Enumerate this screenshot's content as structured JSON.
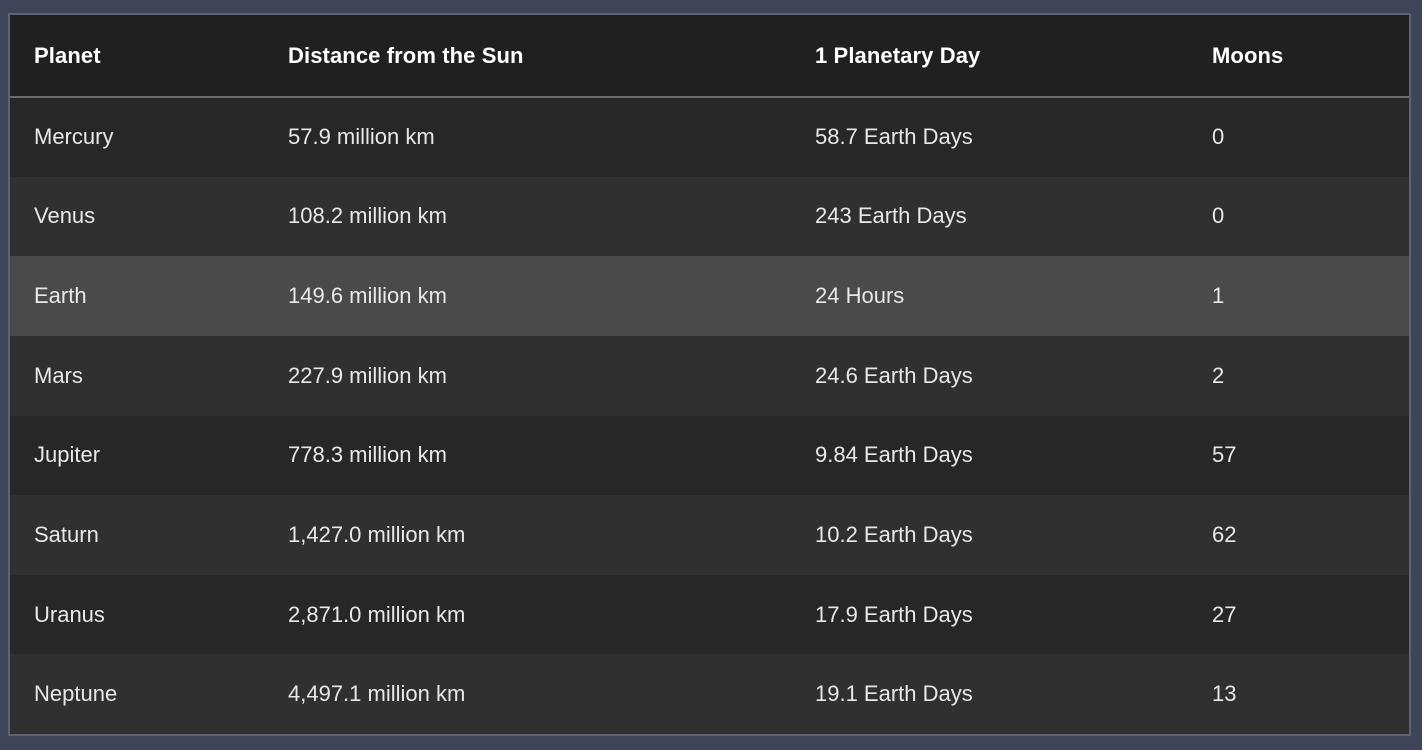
{
  "table": {
    "headers": {
      "planet": "Planet",
      "distance": "Distance from the Sun",
      "day": "1 Planetary Day",
      "moons": "Moons"
    },
    "rows": [
      {
        "planet": "Mercury",
        "distance": "57.9 million km",
        "day": "58.7 Earth Days",
        "moons": "0"
      },
      {
        "planet": "Venus",
        "distance": "108.2 million km",
        "day": "243 Earth Days",
        "moons": "0"
      },
      {
        "planet": "Earth",
        "distance": "149.6 million km",
        "day": "24 Hours",
        "moons": "1"
      },
      {
        "planet": "Mars",
        "distance": "227.9 million km",
        "day": "24.6 Earth Days",
        "moons": "2"
      },
      {
        "planet": "Jupiter",
        "distance": "778.3 million km",
        "day": "9.84 Earth Days",
        "moons": "57"
      },
      {
        "planet": "Saturn",
        "distance": "1,427.0 million km",
        "day": "10.2 Earth Days",
        "moons": "62"
      },
      {
        "planet": "Uranus",
        "distance": "2,871.0 million km",
        "day": "17.9 Earth Days",
        "moons": "27"
      },
      {
        "planet": "Neptune",
        "distance": "4,497.1 million km",
        "day": "19.1 Earth Days",
        "moons": "13"
      }
    ],
    "highlighted_row": 2
  },
  "colors": {
    "page_background": "#3f4558",
    "header_background": "#202020",
    "row_odd": "#272727",
    "row_even": "#303030",
    "row_highlight": "#4a4a4a"
  }
}
